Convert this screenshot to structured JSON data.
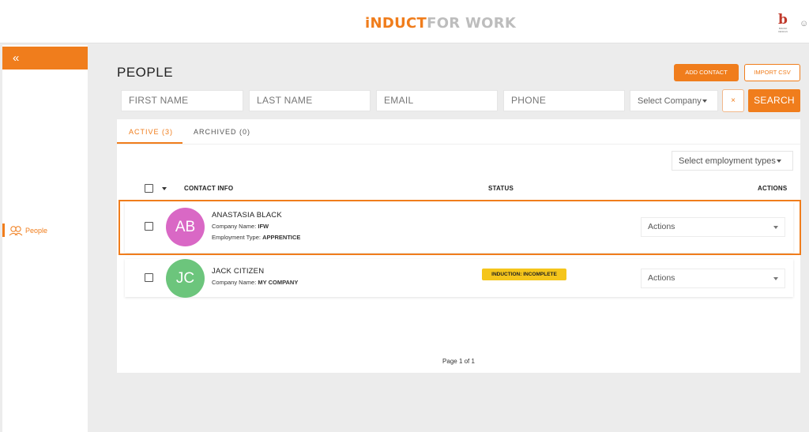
{
  "header": {
    "logo_part1": "iNDUCT",
    "logo_part2": "FOR WORK",
    "brand_mark": "b",
    "brand_tagline": "BRAND DESIGN"
  },
  "sidebar": {
    "collapse_glyph": "«",
    "items": [
      {
        "label": "People",
        "icon": "people-icon"
      }
    ]
  },
  "main": {
    "title": "PEOPLE",
    "add_contact_label": "ADD CONTACT",
    "import_csv_label": "IMPORT CSV",
    "filters": {
      "first_name_placeholder": "FIRST NAME",
      "last_name_placeholder": "LAST NAME",
      "email_placeholder": "EMAIL",
      "phone_placeholder": "PHONE",
      "company_select": "Select Company",
      "clear_label": "×",
      "search_label": "SEARCH"
    },
    "tabs": [
      {
        "label": "ACTIVE (3)"
      },
      {
        "label": "ARCHIVED (0)"
      }
    ],
    "employment_select": "Select employment types",
    "columns": {
      "contact": "CONTACT INFO",
      "status": "STATUS",
      "actions": "ACTIONS"
    },
    "contacts": [
      {
        "initials": "AB",
        "avatar_color": "#d968c5",
        "name": "ANASTASIA BLACK",
        "company_label": "Company Name:",
        "company": "IFW",
        "employment_label": "Employment Type:",
        "employment": "APPRENTICE",
        "status": "",
        "actions_label": "Actions"
      },
      {
        "initials": "JC",
        "avatar_color": "#6cc57c",
        "name": "JACK CITIZEN",
        "company_label": "Company Name:",
        "company": "MY COMPANY",
        "status": "INDUCTION: INCOMPLETE",
        "actions_label": "Actions"
      }
    ],
    "pagination": "Page 1 of 1"
  },
  "colors": {
    "accent": "#f07d1c",
    "status_badge": "#f5c51b"
  }
}
